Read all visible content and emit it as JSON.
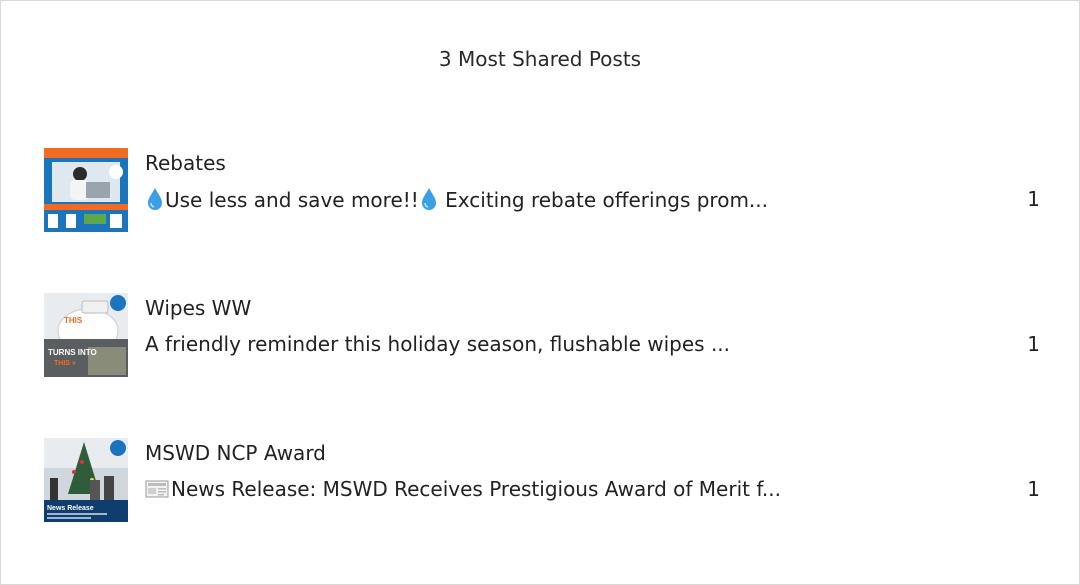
{
  "title": "3 Most Shared Posts",
  "posts": [
    {
      "thumbnail_icon": "rebates-thumbnail",
      "title": "Rebates",
      "text": "Use less and save more!!",
      "text_rest": "Exciting rebate offerings prom...",
      "text_icons": [
        "water-drop-icon",
        "water-drop-icon"
      ],
      "count": "1"
    },
    {
      "thumbnail_icon": "wipes-thumbnail",
      "title": "Wipes WW",
      "text": "A friendly reminder this holiday season, flushable wipes ...",
      "count": "1"
    },
    {
      "thumbnail_icon": "award-thumbnail",
      "title": "MSWD NCP Award",
      "text": "News Release: MSWD Receives Prestigious Award of Merit f...",
      "text_icons": [
        "newspaper-icon"
      ],
      "count": "1"
    }
  ],
  "thumbnail_texts": {
    "wipes_this": "THIS",
    "wipes_turns": "TURNS INTO",
    "wipes_this2": "THIS »",
    "award_label": "News Release"
  },
  "colors": {
    "brand_blue": "#1b75bc",
    "drop_blue": "#3aa0e6",
    "accent_orange": "#f26b21"
  }
}
